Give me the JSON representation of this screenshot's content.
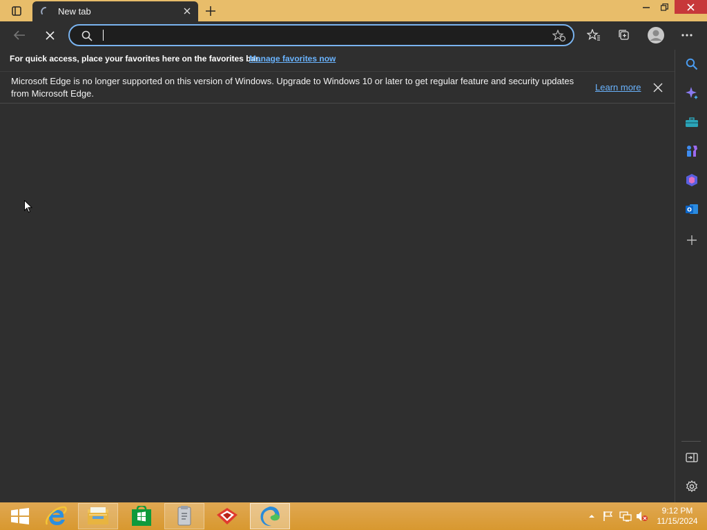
{
  "tab": {
    "title": "New tab",
    "close_label": "×"
  },
  "address_bar": {
    "value": "",
    "placeholder": ""
  },
  "favorites_bar": {
    "text": "For quick access, place your favorites here on the favorites bar.",
    "link": "Manage favorites now"
  },
  "info_bar": {
    "message": "Microsoft Edge is no longer supported on this version of Windows. Upgrade to Windows 10 or later to get regular feature and security updates from Microsoft Edge.",
    "learn_more": "Learn more"
  },
  "clock": {
    "time": "9:12 PM",
    "date": "11/15/2024"
  },
  "colors": {
    "accent": "#7ab4f0",
    "link": "#6ab4ff",
    "background": "#2f2f2f",
    "titlebar": "#e8bd6a"
  },
  "sidebar": {
    "items": [
      "search-icon",
      "copilot-icon",
      "tools-icon",
      "games-icon",
      "office-icon",
      "outlook-icon",
      "add-icon",
      "hide-sidebar-icon",
      "settings-icon"
    ]
  },
  "taskbar": {
    "items": [
      "start-icon",
      "internet-explorer-icon",
      "file-explorer-icon",
      "store-icon",
      "app-icon",
      "app-icon-red",
      "edge-icon"
    ]
  }
}
